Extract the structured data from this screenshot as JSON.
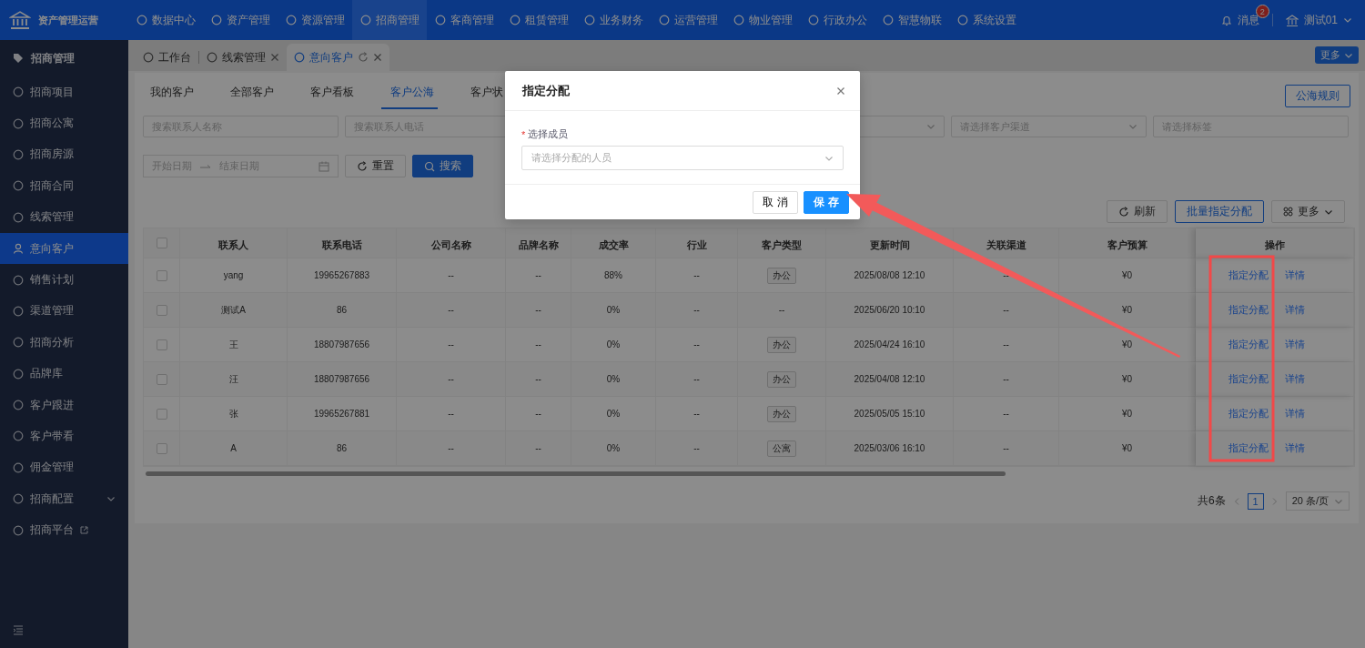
{
  "app": {
    "title": "资产管理运营"
  },
  "top_nav": [
    {
      "label": "数据中心",
      "selected": false
    },
    {
      "label": "资产管理",
      "selected": false
    },
    {
      "label": "资源管理",
      "selected": false
    },
    {
      "label": "招商管理",
      "selected": true
    },
    {
      "label": "客商管理",
      "selected": false
    },
    {
      "label": "租赁管理",
      "selected": false
    },
    {
      "label": "业务财务",
      "selected": false
    },
    {
      "label": "运营管理",
      "selected": false
    },
    {
      "label": "物业管理",
      "selected": false
    },
    {
      "label": "行政办公",
      "selected": false
    },
    {
      "label": "智慧物联",
      "selected": false
    },
    {
      "label": "系统设置",
      "selected": false
    }
  ],
  "notifications": {
    "label": "消息",
    "badge": "2"
  },
  "user": {
    "name": "测试01"
  },
  "sidebar": {
    "header": "招商管理",
    "items": [
      {
        "label": "招商项目",
        "selected": false,
        "kind": "item"
      },
      {
        "label": "招商公寓",
        "selected": false,
        "kind": "item"
      },
      {
        "label": "招商房源",
        "selected": false,
        "kind": "item"
      },
      {
        "label": "招商合同",
        "selected": false,
        "kind": "item"
      },
      {
        "label": "线索管理",
        "selected": false,
        "kind": "item"
      },
      {
        "label": "意向客户",
        "selected": true,
        "kind": "item"
      },
      {
        "label": "销售计划",
        "selected": false,
        "kind": "item"
      },
      {
        "label": "渠道管理",
        "selected": false,
        "kind": "item"
      },
      {
        "label": "招商分析",
        "selected": false,
        "kind": "item"
      },
      {
        "label": "品牌库",
        "selected": false,
        "kind": "item"
      },
      {
        "label": "客户跟进",
        "selected": false,
        "kind": "item"
      },
      {
        "label": "客户带看",
        "selected": false,
        "kind": "item"
      },
      {
        "label": "佣金管理",
        "selected": false,
        "kind": "item"
      },
      {
        "label": "招商配置",
        "selected": false,
        "kind": "group"
      },
      {
        "label": "招商平台",
        "selected": false,
        "kind": "external"
      }
    ]
  },
  "page_tabs": [
    {
      "label": "工作台",
      "selected": false,
      "closable": false
    },
    {
      "label": "线索管理",
      "selected": false,
      "closable": true
    },
    {
      "label": "意向客户",
      "selected": true,
      "closable": true
    }
  ],
  "page_tabs_more": "更多",
  "sub_tabs": [
    {
      "label": "我的客户",
      "selected": false
    },
    {
      "label": "全部客户",
      "selected": false
    },
    {
      "label": "客户看板",
      "selected": false
    },
    {
      "label": "客户公海",
      "selected": true
    },
    {
      "label": "客户状",
      "selected": false
    }
  ],
  "rules_button": "公海规则",
  "filters": {
    "fields": [
      {
        "kind": "text",
        "placeholder": "搜索联系人名称"
      },
      {
        "kind": "text",
        "placeholder": "搜索联系人电话"
      },
      {
        "kind": "hidden"
      },
      {
        "kind": "select"
      },
      {
        "kind": "select",
        "placeholder": "请选择客户渠道"
      },
      {
        "kind": "text",
        "placeholder": "请选择标签"
      }
    ],
    "date_start": "开始日期",
    "date_end": "结束日期",
    "reset_button": "重置",
    "search_button": "搜索"
  },
  "toolbar": {
    "refresh_button": "刷新",
    "batch_button": "批量指定分配",
    "more_button": "更多"
  },
  "table": {
    "all_checked": false,
    "columns": [
      "联系人",
      "联系电话",
      "公司名称",
      "品牌名称",
      "成交率",
      "行业",
      "客户类型",
      "更新时间",
      "关联渠道",
      "客户预算",
      "操作"
    ],
    "rows": [
      {
        "checked": false,
        "type_tagged": true,
        "cells": [
          "yang",
          "19965267883",
          "--",
          "--",
          "88%",
          "--",
          "办公",
          "2025/08/08 12:10",
          "--",
          "¥0"
        ],
        "actions": [
          "指定分配",
          "详情"
        ]
      },
      {
        "checked": false,
        "type_tagged": false,
        "cells": [
          "测试A",
          "86",
          "--",
          "--",
          "0%",
          "--",
          "--",
          "2025/06/20 10:10",
          "--",
          "¥0"
        ],
        "actions": [
          "指定分配",
          "详情"
        ]
      },
      {
        "checked": false,
        "type_tagged": true,
        "cells": [
          "王",
          "18807987656",
          "--",
          "--",
          "0%",
          "--",
          "办公",
          "2025/04/24 16:10",
          "--",
          "¥0"
        ],
        "actions": [
          "指定分配",
          "详情"
        ]
      },
      {
        "checked": false,
        "type_tagged": true,
        "cells": [
          "汪",
          "18807987656",
          "--",
          "--",
          "0%",
          "--",
          "办公",
          "2025/04/08 12:10",
          "--",
          "¥0"
        ],
        "actions": [
          "指定分配",
          "详情"
        ]
      },
      {
        "checked": false,
        "type_tagged": true,
        "cells": [
          "张",
          "19965267881",
          "--",
          "--",
          "0%",
          "--",
          "办公",
          "2025/05/05 15:10",
          "--",
          "¥0"
        ],
        "actions": [
          "指定分配",
          "详情"
        ]
      },
      {
        "checked": false,
        "type_tagged": true,
        "cells": [
          "A",
          "86",
          "--",
          "--",
          "0%",
          "--",
          "公寓",
          "2025/03/06 16:10",
          "--",
          "¥0"
        ],
        "actions": [
          "指定分配",
          "详情"
        ]
      }
    ]
  },
  "pagination": {
    "total": "共6条",
    "page": "1",
    "page_size": "20 条/页"
  },
  "dialog": {
    "title": "指定分配",
    "required_mark": "*",
    "field_label": "选择成员",
    "placeholder": "请选择分配的人员",
    "cancel_button": "取 消",
    "save_button": "保 存"
  }
}
